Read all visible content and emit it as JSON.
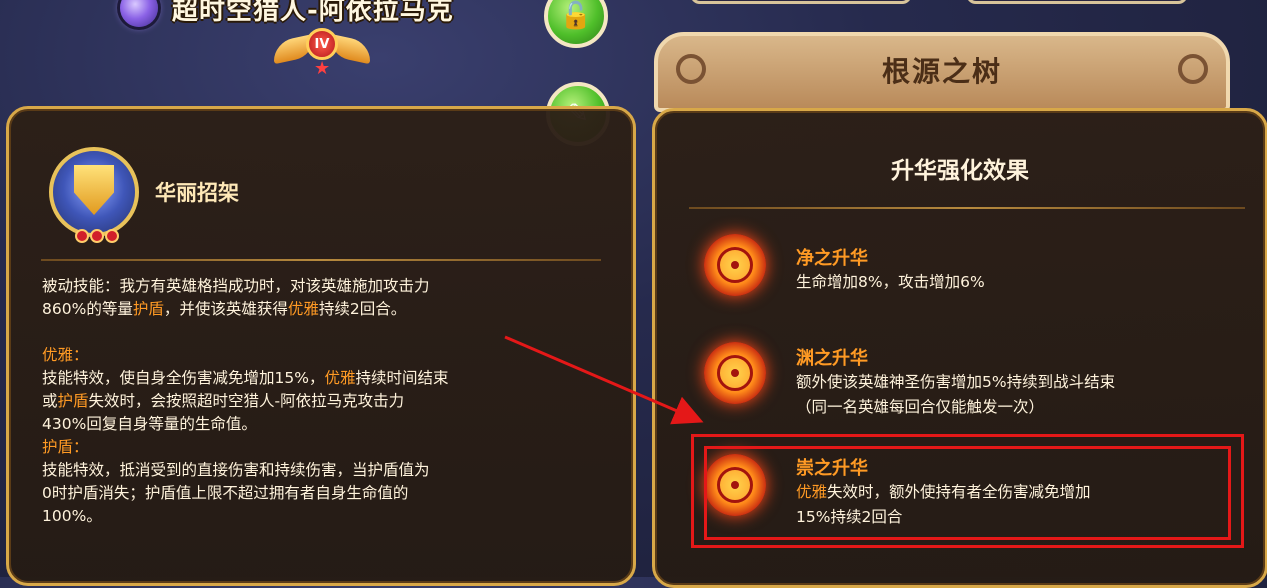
{
  "hero": {
    "name": "超时空猎人-阿依拉马克",
    "rank": "IV"
  },
  "skill": {
    "name": "华丽招架",
    "passive": {
      "p1": "被动技能：我方有英雄格挡成功时，对该英雄施加攻击力",
      "p2a": "860%的等量",
      "p2b": "护盾",
      "p2c": "，并使该英雄获得",
      "p2d": "优雅",
      "p2e": "持续2回合。"
    },
    "grace": {
      "title": "优雅：",
      "l1a": "技能特效，使自身全伤害减免增加15%，",
      "l1b": "优雅",
      "l1c": "持续时间结束",
      "l2a": "或",
      "l2b": "护盾",
      "l2c": "失效时，会按照超时空猎人-阿依拉马克攻击力",
      "l3": "430%回复自身等量的生命值。"
    },
    "shield": {
      "title": "护盾：",
      "l1": "技能特效，抵消受到的直接伤害和持续伤害，当护盾值为",
      "l2": "0时护盾消失；护盾值上限不超过拥有者自身生命值的",
      "l3": "100%。"
    }
  },
  "tree": {
    "title": "根源之树",
    "heading": "升华强化效果",
    "ascensions": [
      {
        "name": "净之升华",
        "line1": "生命增加8%，攻击增加6%"
      },
      {
        "name": "渊之升华",
        "line1": "额外使该英雄神圣伤害增加5%持续到战斗结束",
        "line2": "（同一名英雄每回合仅能触发一次）"
      },
      {
        "name": "崇之升华",
        "line1a": "优雅",
        "line1b": "失效时，额外使持有者全伤害减免增加",
        "line2": "15%持续2回合"
      }
    ]
  },
  "colors": {
    "highlight_text": "#ff9a24",
    "annotation_red": "#e41818",
    "panel_border": "#d8a848"
  }
}
